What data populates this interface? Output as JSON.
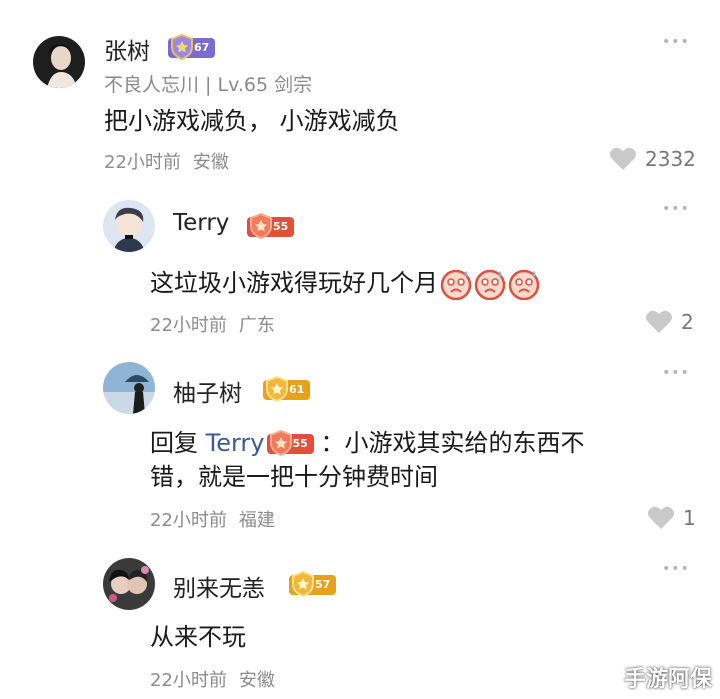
{
  "comments": [
    {
      "name": "张树",
      "level_badge": "67",
      "subtitle": "不良人忘川 | Lv.65 剑宗",
      "content": "把小游戏减负，  小游戏减负",
      "time": "22小时前",
      "location": "安徽",
      "likes": "2332",
      "badge_color": "#7b6bd0"
    },
    {
      "name": "Terry",
      "level_badge": "55",
      "content": "这垃圾小游戏得玩好几个月",
      "time": "22小时前",
      "location": "广东",
      "likes": "2",
      "badge_color": "#e0503a"
    },
    {
      "name": "柚子树",
      "level_badge": "61",
      "reply_prefix": "回复",
      "reply_to": "Terry",
      "reply_badge": "55",
      "content_line1": "：小游戏其实给的东西不",
      "content_line2": "错，就是一把十分钟费时间",
      "time": "22小时前",
      "location": "福建",
      "likes": "1",
      "badge_color": "#e6a21a"
    },
    {
      "name": "别来无恙",
      "level_badge": "57",
      "content": "从来不玩",
      "time": "22小时前",
      "location": "安徽",
      "badge_color": "#e6a21a"
    }
  ],
  "more_icon": "•••",
  "watermark": "手游阿保"
}
